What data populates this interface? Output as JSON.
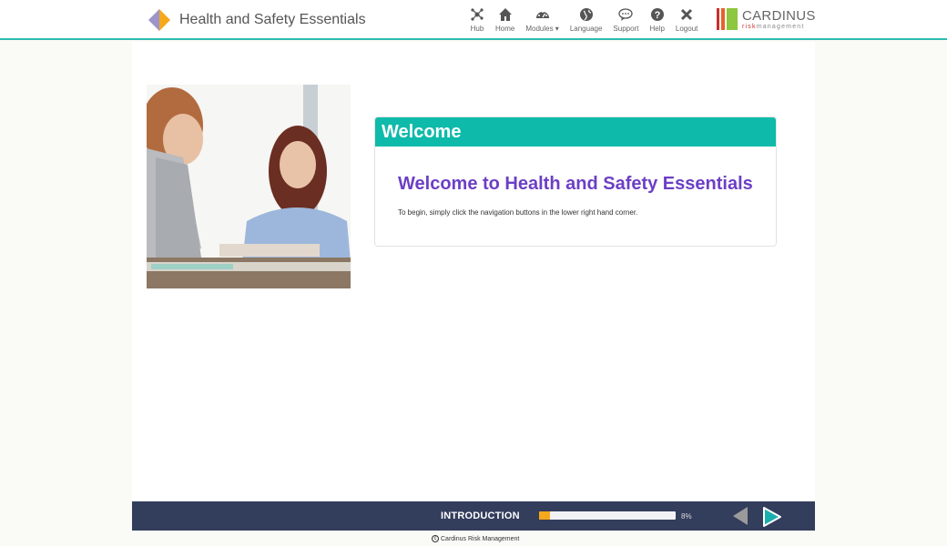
{
  "header": {
    "title": "Health and Safety Essentials",
    "nav": [
      {
        "icon": "hub-icon",
        "label": "Hub"
      },
      {
        "icon": "home-icon",
        "label": "Home"
      },
      {
        "icon": "dashboard-icon",
        "label": "Modules ▾"
      },
      {
        "icon": "globe-icon",
        "label": "Language"
      },
      {
        "icon": "chat-icon",
        "label": "Support"
      },
      {
        "icon": "question-icon",
        "label": "Help"
      },
      {
        "icon": "close-icon",
        "label": "Logout"
      }
    ],
    "partner": {
      "name": "CARDINUS",
      "sub_a": "risk",
      "sub_b": "management"
    }
  },
  "colors": {
    "accent": "#0ebaaa",
    "heading": "#6c3fc5",
    "footer": "#333d5c",
    "progress": "#f5a81c"
  },
  "card": {
    "header": "Welcome",
    "title": "Welcome to Health and Safety Essentials",
    "text": "To begin, simply click the navigation buttons in the lower right hand corner."
  },
  "footer": {
    "section": "INTRODUCTION",
    "progress_percent": 8,
    "progress_label": "8%",
    "copyright": "Cardinus Risk Management"
  }
}
